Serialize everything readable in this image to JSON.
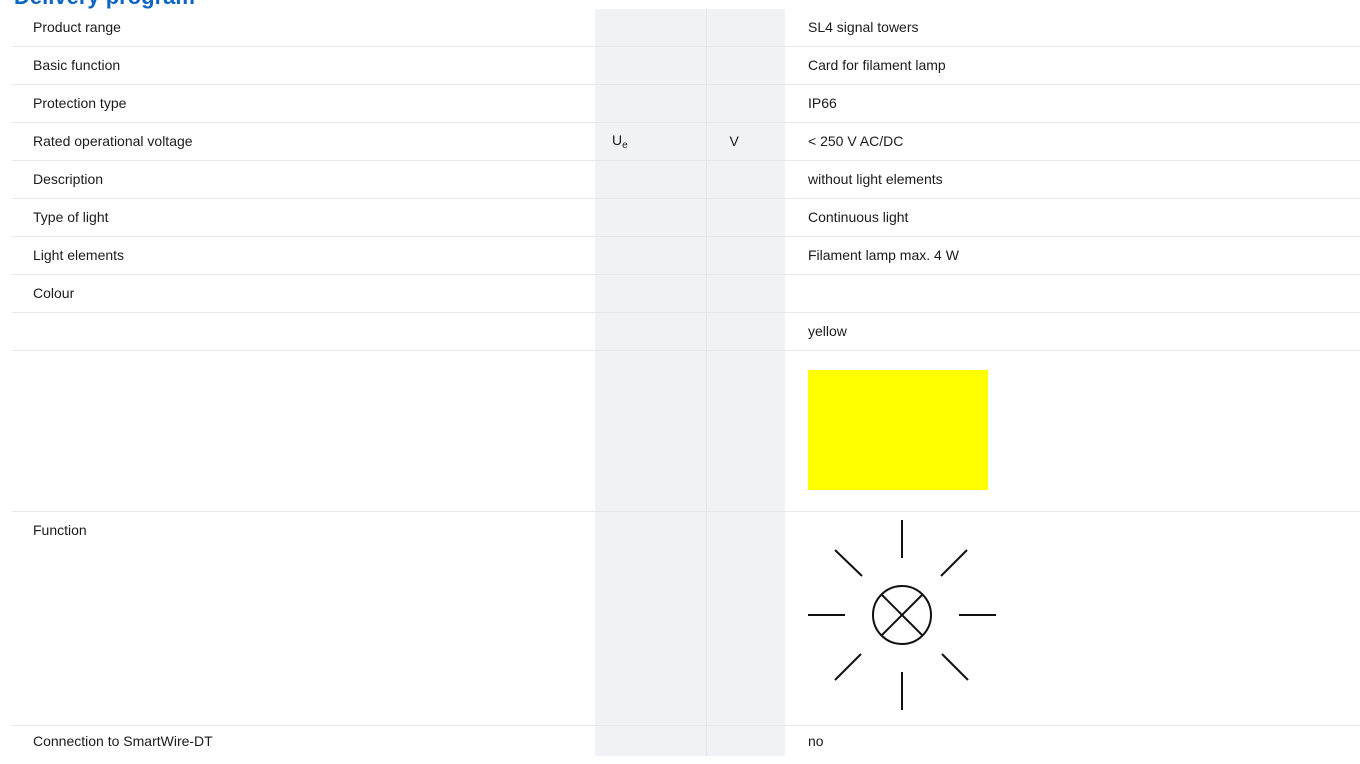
{
  "header": {
    "title": "Delivery program"
  },
  "colors": {
    "accent": "#0b66c3",
    "swatch": "#ffff00",
    "column_shade": "#f0f2f6"
  },
  "rows": [
    {
      "label": "Product range",
      "symbol": "",
      "unit": "",
      "value": "SL4 signal towers"
    },
    {
      "label": "Basic function",
      "symbol": "",
      "unit": "",
      "value": "Card for filament lamp"
    },
    {
      "label": "Protection type",
      "symbol": "",
      "unit": "",
      "value": "IP66"
    },
    {
      "label": "Rated operational voltage",
      "symbol_main": "U",
      "symbol_sub": "e",
      "unit": "V",
      "value": "< 250 V AC/DC"
    },
    {
      "label": "Description",
      "symbol": "",
      "unit": "",
      "value": "without light elements"
    },
    {
      "label": "Type of light",
      "symbol": "",
      "unit": "",
      "value": "Continuous light"
    },
    {
      "label": "Light elements",
      "symbol": "",
      "unit": "",
      "value": "Filament lamp max. 4 W"
    },
    {
      "label": "Colour",
      "symbol": "",
      "unit": "",
      "value": ""
    },
    {
      "label": "",
      "symbol": "",
      "unit": "",
      "value": "yellow"
    },
    {
      "label": "",
      "symbol": "",
      "unit": "",
      "value": "",
      "swatch": "yellow-color-swatch"
    },
    {
      "label": "Function",
      "symbol": "",
      "unit": "",
      "value": "",
      "icon": "flashing-lamp-icon"
    },
    {
      "label": "Connection to SmartWire-DT",
      "symbol": "",
      "unit": "",
      "value": "no"
    }
  ]
}
